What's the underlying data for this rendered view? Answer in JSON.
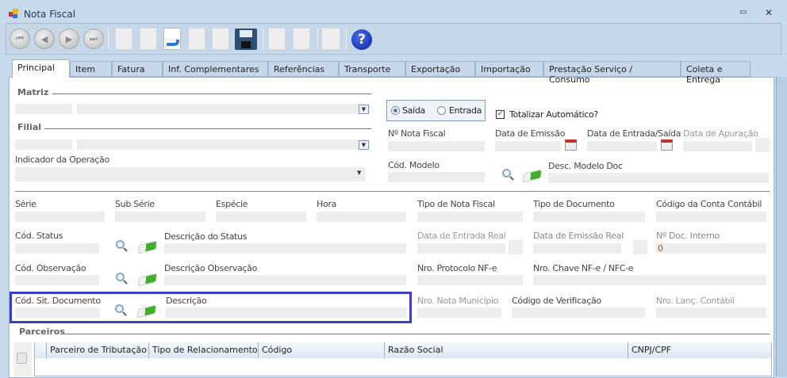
{
  "window": {
    "title": "Nota Fiscal",
    "minimize": "▭",
    "close": "✕"
  },
  "tabs": [
    "Principal",
    "Item",
    "Fatura",
    "Inf. Complementares",
    "Referências",
    "Transporte",
    "Exportação",
    "Importação",
    "Prestação Serviço / Consumo",
    "Coleta e Entrega"
  ],
  "sections": {
    "matriz": "Matriz",
    "filial": "Filial",
    "parceiros": "Parceiros"
  },
  "fields": {
    "indicador": "Indicador da Operação",
    "saida": "Saída",
    "entrada": "Entrada",
    "totalizar": "Totalizar Automático?",
    "nota": "Nº Nota Fiscal",
    "emissao": "Data de Emissão",
    "entrada_saida": "Data de Entrada/Saída",
    "apuracao": "Data de Apuração",
    "cod_modelo": "Cód. Modelo",
    "desc_modelo": "Desc. Modelo Doc",
    "serie": "Série",
    "sub_serie": "Sub Série",
    "especie": "Espécie",
    "hora": "Hora",
    "tipo_nf": "Tipo de Nota Fiscal",
    "tipo_doc": "Tipo de Documento",
    "conta": "Código da Conta Contábil",
    "cod_status": "Cód. Status",
    "desc_status": "Descrição do Status",
    "entrada_real": "Data de Entrada Real",
    "emissao_real": "Data de Emissão Real",
    "doc_interno": "Nº Doc. Interno",
    "doc_interno_value": "0",
    "cod_obs": "Cód. Observação",
    "desc_obs": "Descrição Observação",
    "protocolo": "Nro. Protocolo NF-e",
    "chave": "Nro. Chave NF-e / NFC-e",
    "cod_sit": "Cód. Sit. Documento",
    "descricao": "Descrição",
    "nota_mun": "Nro. Nota Município",
    "cod_verif": "Código de Verificação",
    "lanc": "Nro. Lanç. Contábil"
  },
  "grid": {
    "columns": [
      "Parceiro de Tributação",
      "Tipo de Relacionamento",
      "Código",
      "Razão Social",
      "CNPJ/CPF"
    ]
  },
  "colors": {
    "highlight": "#3a3fc4",
    "accent": "#1d3fa8"
  }
}
